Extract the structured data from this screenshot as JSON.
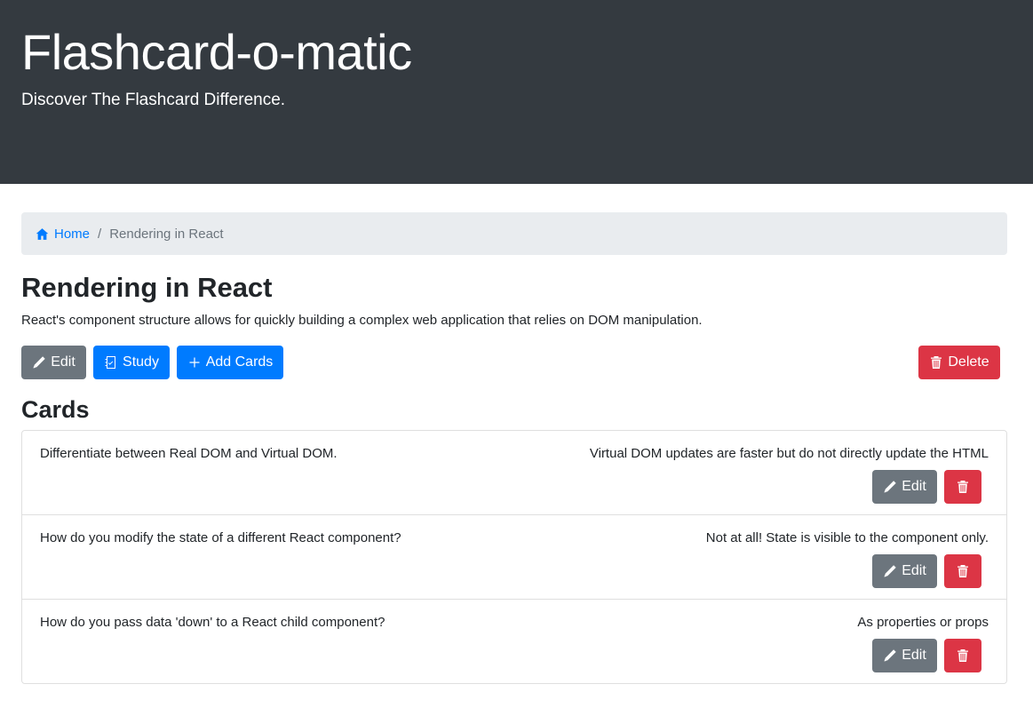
{
  "header": {
    "title": "Flashcard-o-matic",
    "tagline": "Discover The Flashcard Difference."
  },
  "breadcrumb": {
    "home_label": "Home",
    "separator": "/",
    "current": "Rendering in React"
  },
  "deck": {
    "name": "Rendering in React",
    "description": "React's component structure allows for quickly building a complex web application that relies on DOM manipulation.",
    "actions": {
      "edit_label": "Edit",
      "study_label": "Study",
      "add_cards_label": "Add Cards",
      "delete_label": "Delete"
    }
  },
  "cards_section": {
    "heading": "Cards",
    "edit_label": "Edit",
    "items": [
      {
        "front": "Differentiate between Real DOM and Virtual DOM.",
        "back": "Virtual DOM updates are faster but do not directly update the HTML"
      },
      {
        "front": "How do you modify the state of a different React component?",
        "back": "Not at all! State is visible to the component only."
      },
      {
        "front": "How do you pass data 'down' to a React child component?",
        "back": "As properties or props"
      }
    ]
  },
  "colors": {
    "header_bg": "#343a40",
    "primary": "#007bff",
    "secondary": "#6c757d",
    "danger": "#dc3545",
    "breadcrumb_bg": "#e9ecef"
  },
  "icons": {
    "home": "house-icon",
    "edit": "pencil-icon",
    "study": "journal-check-icon",
    "add": "plus-icon",
    "delete": "trash-icon"
  }
}
